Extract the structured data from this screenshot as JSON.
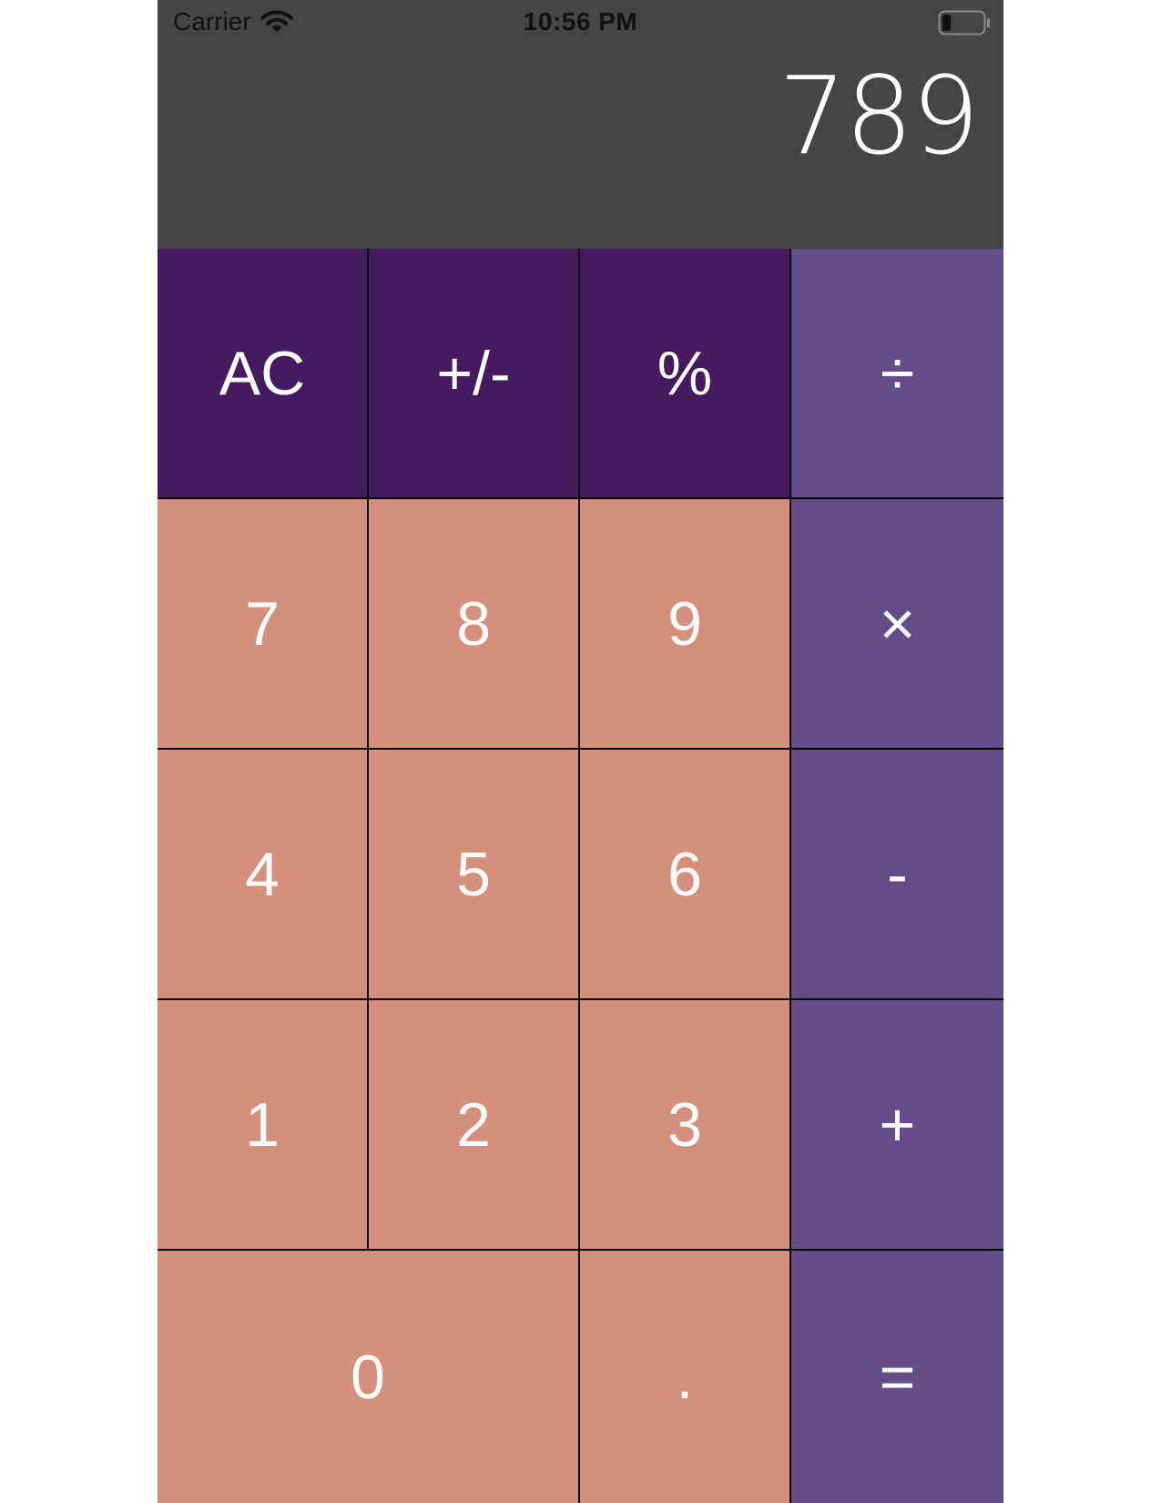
{
  "status_bar": {
    "carrier": "Carrier",
    "time": "10:56 PM",
    "wifi_icon": "wifi-icon",
    "battery_icon": "battery-icon"
  },
  "display": {
    "value": "789"
  },
  "colors": {
    "display_background": "#454545",
    "function_key": "#461a5e",
    "number_key": "#d4907d",
    "operator_key": "#654d89",
    "key_text": "#ffffff"
  },
  "keys": {
    "ac": "AC",
    "plus_minus": "+/-",
    "percent": "%",
    "divide": "÷",
    "seven": "7",
    "eight": "8",
    "nine": "9",
    "multiply": "×",
    "four": "4",
    "five": "5",
    "six": "6",
    "subtract": "-",
    "one": "1",
    "two": "2",
    "three": "3",
    "add": "+",
    "zero": "0",
    "decimal": ".",
    "equals": "="
  }
}
